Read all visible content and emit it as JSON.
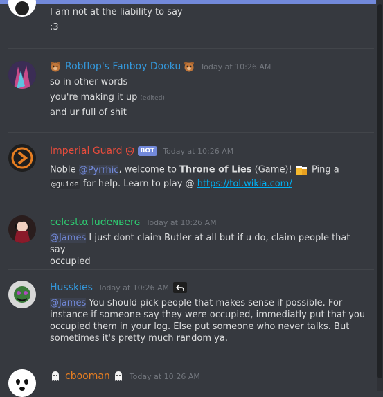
{
  "messages": [
    {
      "lines": [
        "I am not at the liability to say",
        ":3"
      ]
    },
    {
      "author": "Robflop's Fanboy Dooku",
      "author_color": "#3498db",
      "timestamp": "Today at 10:26 AM",
      "lines": [
        "so in other words",
        "you're making it up",
        "and ur full of shit"
      ],
      "edited": "(edited)"
    },
    {
      "author": "Imperial Guard",
      "author_color": "#e74c3c",
      "badge": "BOT",
      "timestamp": "Today at 10:26 AM",
      "line1_a": "Noble ",
      "mention": "@Pyrrhic",
      "line1_b": ", welcome to ",
      "bold": "Throne of Lies",
      "line1_c": " (Game)! ",
      "line1_d": " Ping a",
      "code": "@guide",
      "line2_a": " for help. Learn to play @ ",
      "link": "https://tol.wikia.com/"
    },
    {
      "author": "celestια ludeɴвerɢ",
      "author_color": "#2ecc71",
      "timestamp": "Today at 10:26 AM",
      "mention": "@James",
      "text_a": " I just dont claim Butler at all but if u do, claim people that say",
      "text_b": "occupied"
    },
    {
      "author": "Husskies",
      "author_color": "#3498db",
      "timestamp": "Today at 10:26 AM",
      "mention": "@James",
      "l1": " You should pick people that makes sense if possible. For",
      "l2": "instance if someone say they were occupied, immediatly put that you",
      "l3": "occupied them in your log. Else put someone who never talks. But",
      "l4": "sometimes it's pretty much random ya."
    },
    {
      "author": "cbooman",
      "author_color": "#e67e22",
      "timestamp": "Today at 10:26 AM"
    }
  ]
}
